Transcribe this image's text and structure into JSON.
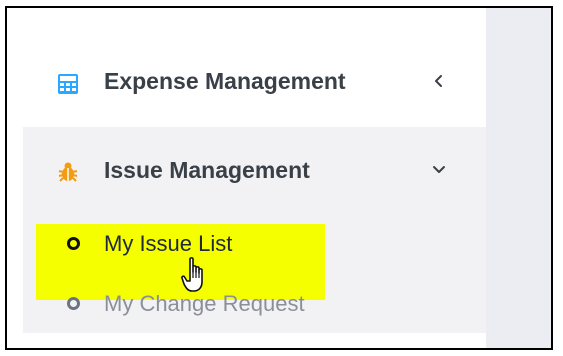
{
  "sidebar": {
    "items": [
      {
        "label": "Expense Management",
        "icon": "calculator-icon",
        "icon_color": "#29a8ff",
        "chevron": "chevron-left-icon",
        "expanded": false
      },
      {
        "label": "Issue Management",
        "icon": "bug-icon",
        "icon_color": "#f39c12",
        "chevron": "chevron-down-icon",
        "expanded": true,
        "children": [
          {
            "label": "My Issue List",
            "icon": "circle-icon",
            "highlighted": true
          },
          {
            "label": "My Change Request",
            "icon": "circle-icon",
            "highlighted": false
          }
        ]
      }
    ]
  },
  "colors": {
    "highlight": "#f5ff00",
    "content_background": "#ebedf3",
    "active_group_background": "#f2f2f4",
    "text_primary": "#3a4047",
    "text_muted": "#8a8f99"
  }
}
